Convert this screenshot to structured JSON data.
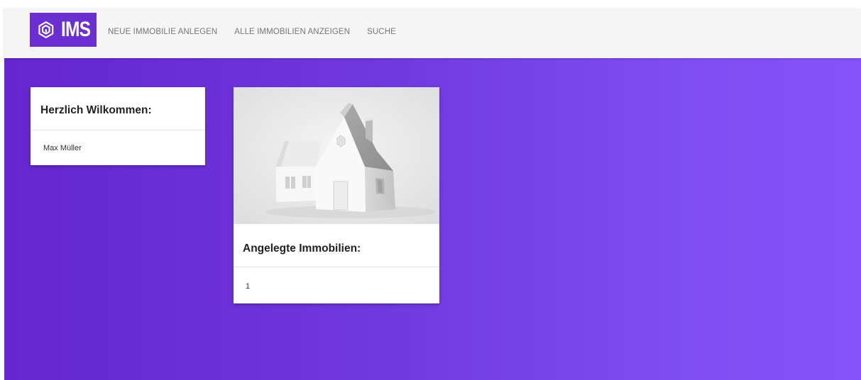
{
  "navbar": {
    "logo_text": "IMS",
    "links": [
      {
        "label": "NEUE IMMOBILIE ANLEGEN"
      },
      {
        "label": "ALLE IMMOBILIEN ANZEIGEN"
      },
      {
        "label": "SUCHE"
      }
    ]
  },
  "welcome_card": {
    "title": "Herzlich Wilkommen:",
    "user_name": "Max Müller"
  },
  "property_card": {
    "image_icon": "house-image",
    "title": "Angelegte Immobilien:",
    "count": "1"
  },
  "colors": {
    "brand": "#6a2ed1",
    "gradient_start": "#6426cf",
    "gradient_end": "#8751fb",
    "navbar_bg": "#f5f5f5",
    "nav_text": "#777777"
  }
}
